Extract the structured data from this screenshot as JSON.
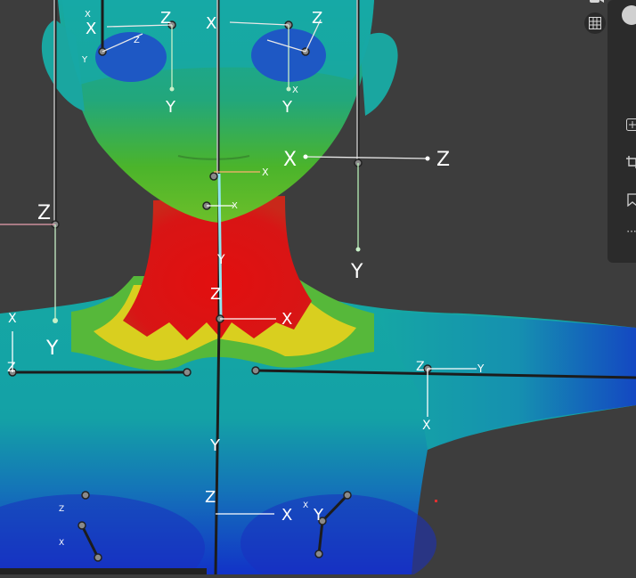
{
  "viewport": {
    "axis_labels": {
      "x": "X",
      "y": "Y",
      "z": "Z"
    }
  },
  "toolbar": {
    "grid_icon": "grid-icon",
    "camera_icon": "camera-icon"
  },
  "side_panel": {
    "icons": [
      "plus-icon",
      "crop-icon",
      "bookmark-icon",
      "more-icon"
    ],
    "more_glyph": "···"
  },
  "colors": {
    "background": "#3d3d3d",
    "panel": "#2b2b2b",
    "heat_red": "#e11010",
    "heat_yellow": "#d6d21c",
    "heat_green": "#49b82a",
    "heat_cyan": "#13a8a6",
    "heat_blue": "#1238c8"
  }
}
